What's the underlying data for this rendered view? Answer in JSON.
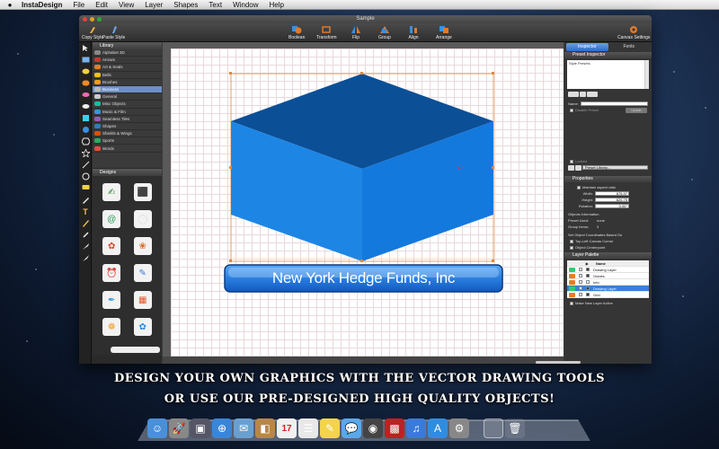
{
  "menubar": {
    "apple": "",
    "items": [
      "InstaDesign",
      "File",
      "Edit",
      "View",
      "Layer",
      "Shapes",
      "Text",
      "Window",
      "Help"
    ]
  },
  "window": {
    "title": "Sample"
  },
  "toolbar": {
    "copy_style": "Copy Style",
    "paste_style": "Paste Style",
    "boolean": "Boolean",
    "transform": "Transform",
    "flip": "Flip",
    "group": "Group",
    "align": "Align",
    "arrange": "Arrange",
    "canvas_settings": "Canvas Settings"
  },
  "library": {
    "title": "Library",
    "items": [
      {
        "label": "Alphabet 3D",
        "color": "#888888"
      },
      {
        "label": "Arrows",
        "color": "#c0392b"
      },
      {
        "label": "Art & Seals",
        "color": "#e67e22"
      },
      {
        "label": "Bells",
        "color": "#f1c40f"
      },
      {
        "label": "Brushes",
        "color": "#f39c12"
      },
      {
        "label": "Business",
        "color": "#bbbbbb"
      },
      {
        "label": "General",
        "color": "#cccccc"
      },
      {
        "label": "Misc Objects",
        "color": "#1abc9c"
      },
      {
        "label": "Music & Film",
        "color": "#3498db"
      },
      {
        "label": "Seamless Tiles",
        "color": "#9b59b6"
      },
      {
        "label": "Shapes",
        "color": "#2980b9"
      },
      {
        "label": "Shields & Wings",
        "color": "#d35400"
      },
      {
        "label": "Sports",
        "color": "#27ae60"
      },
      {
        "label": "Words",
        "color": "#e74c3c"
      }
    ],
    "selected_index": 5
  },
  "designs": {
    "title": "Designs",
    "items": [
      "✍",
      "⬛",
      "@",
      "◯",
      "✿",
      "❀",
      "⏰",
      "✎",
      "✒",
      "▦",
      "❁",
      "✿"
    ]
  },
  "canvas": {
    "banner_text": "New York Hedge Funds, Inc"
  },
  "inspector": {
    "tabs": [
      "Inspector",
      "Fonts"
    ],
    "preset_inspector": "Preset Inspector",
    "style_presets": "Style Presets",
    "name_label": "Name:",
    "disable_preset": "Disable Preset",
    "update_btn": "Update",
    "lock_label": "Locked",
    "preset_library": "Preset Library...",
    "properties": "Properties",
    "maintain_aspect": "Maintain aspect ratio",
    "width_label": "Width:",
    "width_value": "675.97",
    "height_label": "Height:",
    "height_value": "625.75",
    "rotation_label": "Rotation:",
    "rotation_value": "0.00°",
    "objects_information": "Objects information",
    "preset_used_label": "Preset Used:",
    "preset_used_value": "none",
    "group_items_label": "Group Items:",
    "group_items_value": "3",
    "set_coords": "Set Object Coordinates Based On",
    "top_left_canvas": "Top-Left Canvas Corner",
    "object_centerpoint": "Object Centerpoint",
    "layer_palette": "Layer Palette",
    "layer_col_name": "Name",
    "layers": [
      {
        "name": "Drawing Layer",
        "color": "#2ecc71",
        "checked": true,
        "selected": false
      },
      {
        "name": "Guides",
        "color": "#e67e22",
        "checked": true,
        "selected": false
      },
      {
        "name": "Info",
        "color": "#e67e22",
        "checked": false,
        "selected": false
      },
      {
        "name": "Drawing Layer",
        "color": "#2ecc71",
        "checked": true,
        "selected": true
      },
      {
        "name": "Grid",
        "color": "#e67e22",
        "checked": true,
        "selected": false
      }
    ],
    "make_new_layer": "Make New Layer Active"
  },
  "tagline": {
    "line1": "DESIGN YOUR OWN GRAPHICS WITH THE VECTOR DRAWING TOOLS",
    "line2": "OR USE OUR PRE-DESIGNED HIGH QUALITY OBJECTS!"
  },
  "dock": {
    "icons": [
      {
        "name": "finder-icon",
        "glyph": "☺",
        "color": "#4a90d9"
      },
      {
        "name": "launchpad-icon",
        "glyph": "🚀",
        "color": "#888"
      },
      {
        "name": "photo-icon",
        "glyph": "▣",
        "color": "#556"
      },
      {
        "name": "safari-icon",
        "glyph": "⊕",
        "color": "#3a85d8"
      },
      {
        "name": "mail-icon",
        "glyph": "✉",
        "color": "#6aa0d0"
      },
      {
        "name": "contacts-icon",
        "glyph": "◧",
        "color": "#b8874a"
      },
      {
        "name": "calendar-icon",
        "glyph": "17",
        "color": "#f0f0f0"
      },
      {
        "name": "reminders-icon",
        "glyph": "☰",
        "color": "#e8e8e8"
      },
      {
        "name": "notes-icon",
        "glyph": "✎",
        "color": "#f3d44a"
      },
      {
        "name": "messages-icon",
        "glyph": "💬",
        "color": "#5aa8ea"
      },
      {
        "name": "facetime-icon",
        "glyph": "◉",
        "color": "#444"
      },
      {
        "name": "photobooth-icon",
        "glyph": "▩",
        "color": "#b22"
      },
      {
        "name": "itunes-icon",
        "glyph": "♫",
        "color": "#3b7ad8"
      },
      {
        "name": "appstore-icon",
        "glyph": "A",
        "color": "#2f8de0"
      },
      {
        "name": "preferences-icon",
        "glyph": "⚙",
        "color": "#888"
      },
      {
        "name": "folder-icon",
        "glyph": "",
        "color": "rgba(255,255,255,.15)"
      },
      {
        "name": "trash-icon",
        "glyph": "🗑",
        "color": "rgba(255,255,255,.1)"
      }
    ]
  }
}
